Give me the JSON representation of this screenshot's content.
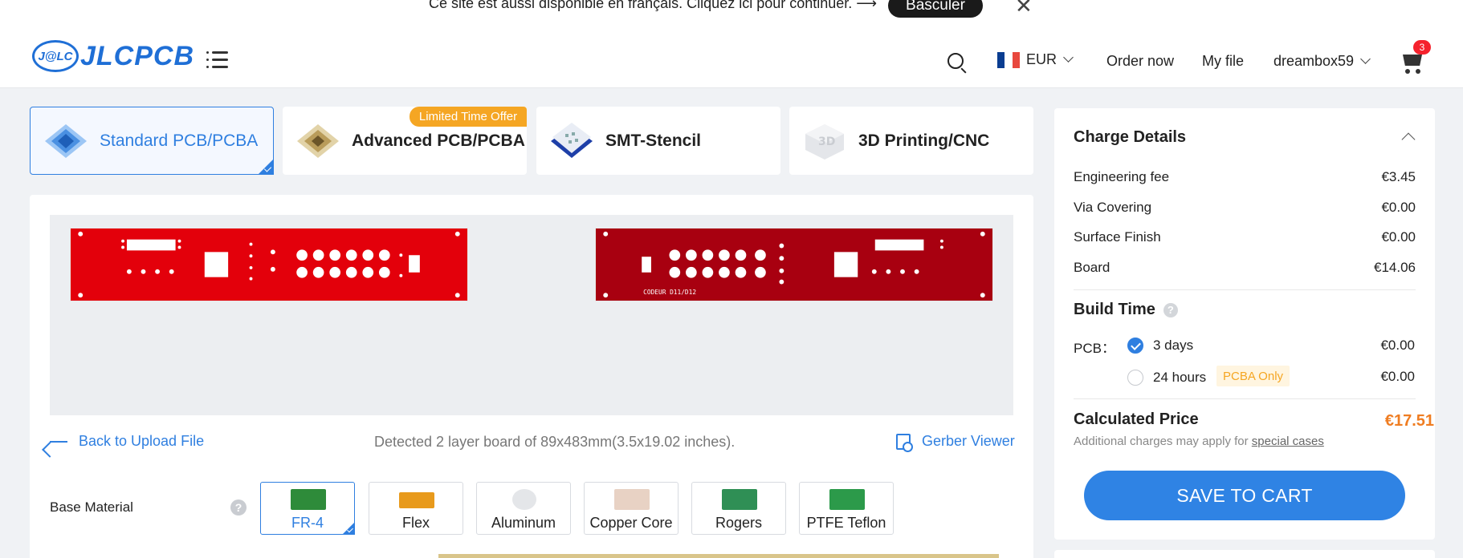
{
  "notice": {
    "text": "Ce site est aussi disponible en français. Cliquez ici pour continuer. ⟶",
    "button": "Basculer"
  },
  "header": {
    "logo_mark": "J@LC",
    "logo_text": "JLCPCB",
    "currency": "EUR",
    "order_now": "Order now",
    "my_file": "My file",
    "user": "dreambox59",
    "cart_count": "3"
  },
  "tabs": [
    {
      "label": "Standard PCB/PCBA",
      "active": true
    },
    {
      "label": "Advanced PCB/PCBA",
      "active": false
    },
    {
      "label": "SMT-Stencil",
      "active": false
    },
    {
      "label": "3D Printing/CNC",
      "active": false
    }
  ],
  "offer_badge": "Limited Time Offer",
  "preview": {
    "pcb2_text": "CODEUR D11/D12"
  },
  "back_link": "Back to Upload File",
  "detected": "Detected 2 layer board of 89x483mm(3.5x19.02 inches).",
  "gerber_viewer": "Gerber Viewer",
  "base_material": {
    "label": "Base Material",
    "help": "?",
    "options": [
      {
        "label": "FR-4",
        "active": true
      },
      {
        "label": "Flex",
        "active": false
      },
      {
        "label": "Aluminum",
        "active": false
      },
      {
        "label": "Copper Core",
        "active": false
      },
      {
        "label": "Rogers",
        "active": false
      },
      {
        "label": "PTFE Teflon",
        "active": false
      }
    ]
  },
  "charge": {
    "title": "Charge Details",
    "fees": [
      {
        "name": "Engineering fee",
        "value": "€3.45"
      },
      {
        "name": "Via Covering",
        "value": "€0.00"
      },
      {
        "name": "Surface Finish",
        "value": "€0.00"
      },
      {
        "name": "Board",
        "value": "€14.06"
      }
    ],
    "build_time_title": "Build Time",
    "build_help": "?",
    "pcb_label": "PCB：",
    "options": [
      {
        "label": "3 days",
        "price": "€0.00",
        "selected": true
      },
      {
        "label": "24 hours",
        "price": "€0.00",
        "selected": false
      }
    ],
    "pcba_only": "PCBA Only",
    "calculated_title": "Calculated Price",
    "calculated_price": "€17.51",
    "note": "Additional charges may apply for ",
    "note_link": "special cases",
    "save_button": "SAVE TO CART"
  },
  "colors": {
    "accent": "#2f7fe0",
    "price": "#ef7d22",
    "pcb1": "#e3000b",
    "pcb2": "#a80010",
    "badge": "#f5a623"
  }
}
